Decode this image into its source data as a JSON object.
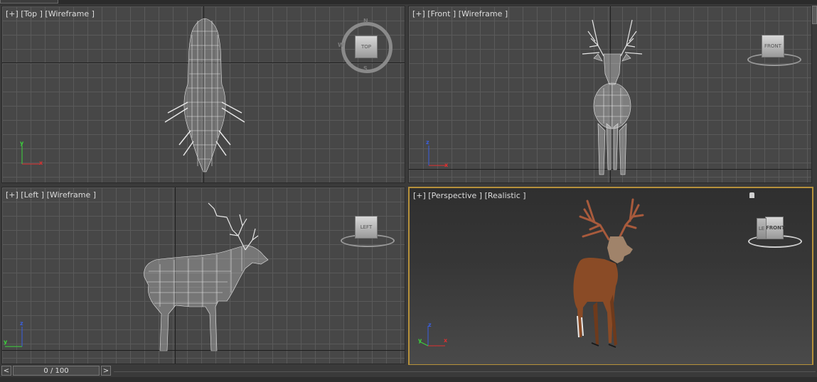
{
  "viewports": {
    "top": {
      "label": "[+] [Top ] [Wireframe ]",
      "viewcube_face": "TOP",
      "compass": {
        "n": "N",
        "s": "S",
        "w": "W"
      }
    },
    "front": {
      "label": "[+] [Front ] [Wireframe ]",
      "viewcube_face": "FRONT"
    },
    "left": {
      "label": "[+] [Left ] [Wireframe ]",
      "viewcube_face": "LEFT"
    },
    "perspective": {
      "label": "[+] [Perspective ] [Realistic ]",
      "viewcube_face": "FRONT",
      "viewcube_side": "LE"
    }
  },
  "axes": {
    "x": "x",
    "y": "y",
    "z": "z"
  },
  "timeline": {
    "frame_display": "0 / 100",
    "prev_label": "<",
    "next_label": ">"
  },
  "colors": {
    "active_border": "#b6913b",
    "grid_bg": "#474747",
    "grid_line": "#5a5a5a",
    "wire": "#e6e6e6",
    "deer_body": "#8a4b26",
    "antler": "#b56140"
  }
}
